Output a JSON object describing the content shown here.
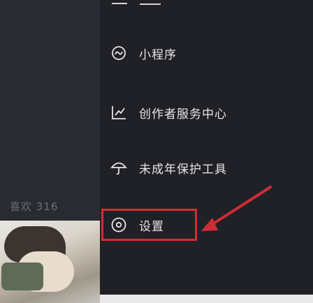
{
  "menu": {
    "items": [
      {
        "id": "mini-program",
        "label": "小程序",
        "icon": "mini-program-icon"
      },
      {
        "id": "creator-center",
        "label": "创作者服务中心",
        "icon": "creator-center-icon"
      },
      {
        "id": "minor-protection",
        "label": "未成年保护工具",
        "icon": "umbrella-icon"
      },
      {
        "id": "settings",
        "label": "设置",
        "icon": "settings-icon"
      }
    ]
  },
  "profile": {
    "likes_label": "喜欢 316"
  },
  "annotation": {
    "highlight_color": "#d12d35",
    "arrow_color": "#d12d35"
  }
}
